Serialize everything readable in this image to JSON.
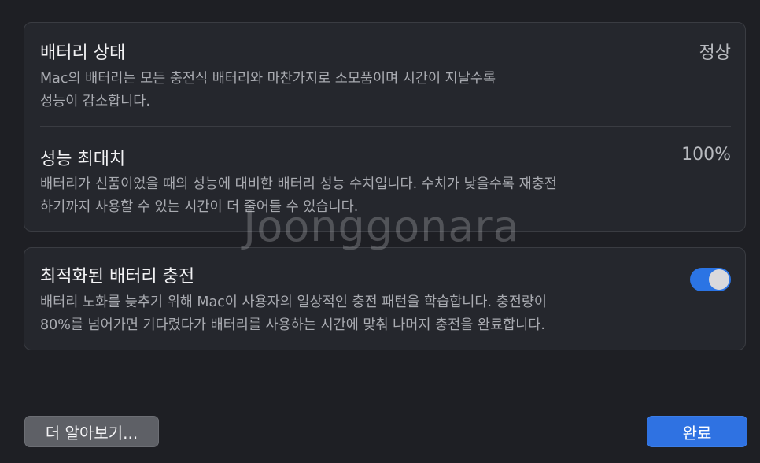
{
  "battery_health": {
    "title": "배터리 상태",
    "value": "정상",
    "description": "Mac의 배터리는 모든 충전식 배터리와 마찬가지로 소모품이며 시간이 지날수록\n성능이 감소합니다."
  },
  "maximum_capacity": {
    "title": "성능 최대치",
    "value": "100%",
    "description": "배터리가 신품이었을 때의 성능에 대비한 배터리 성능 수치입니다. 수치가 낮을수록 재충전\n하기까지 사용할 수 있는 시간이 더 줄어들 수 있습니다."
  },
  "optimized_charging": {
    "title": "최적화된 배터리 충전",
    "enabled": true,
    "description": "배터리 노화를 늦추기 위해 Mac이 사용자의 일상적인 충전 패턴을 학습합니다. 충전량이\n80%를 넘어가면 기다렸다가 배터리를 사용하는 시간에 맞춰 나머지 충전을 완료합니다."
  },
  "watermark": "Joonggonara",
  "buttons": {
    "learn_more": "더 알아보기...",
    "done": "완료"
  },
  "colors": {
    "accent": "#2f72e2",
    "background": "#1e1f24",
    "panel": "#25272d"
  }
}
